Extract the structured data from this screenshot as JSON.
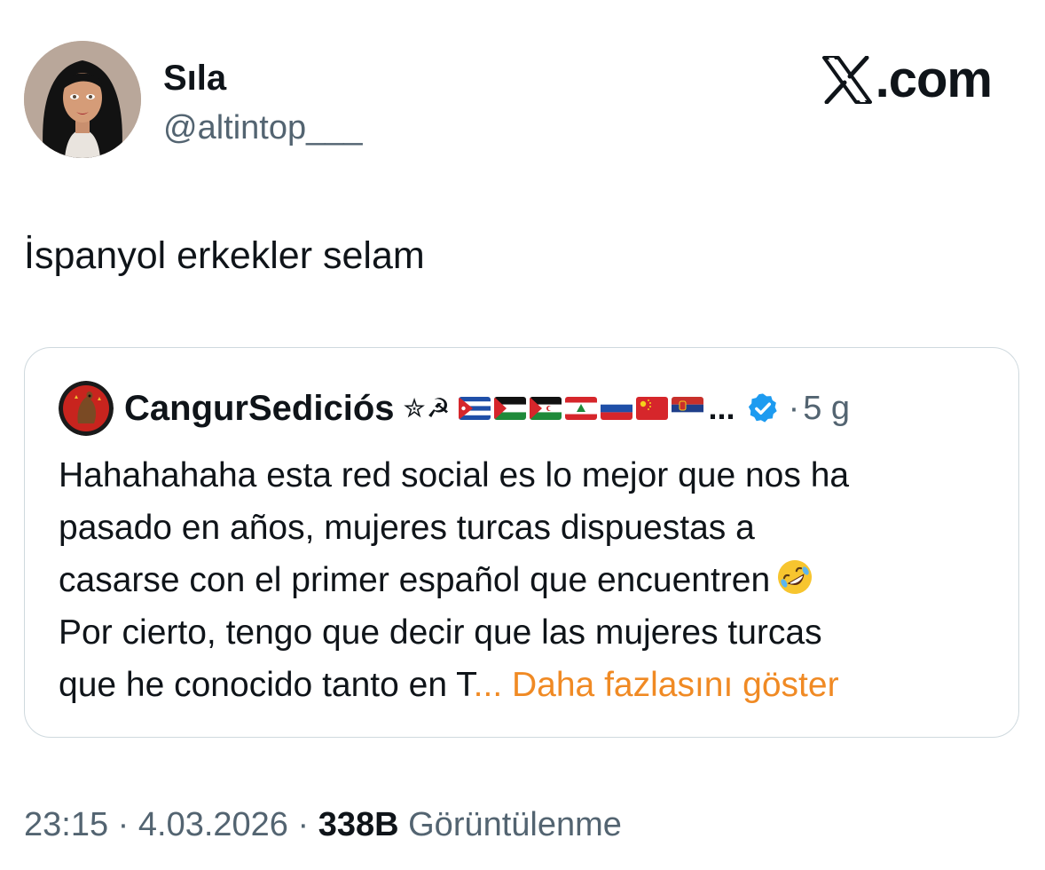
{
  "author": {
    "display_name": "Sıla",
    "handle": "@altintop___"
  },
  "brand": {
    "text": ".com",
    "icon": "x-logo-icon"
  },
  "tweet": {
    "text": "İspanyol erkekler selam"
  },
  "quoted_tweet": {
    "display_name": "CangurSediciós",
    "symbols": "✮☭",
    "flags": [
      "cuba-flag-icon",
      "palestine-flag-icon",
      "sahrawi-flag-icon",
      "lebanon-flag-icon",
      "russia-flag-icon",
      "china-flag-icon",
      "serbia-flag-icon"
    ],
    "name_ellipsis": "...",
    "verified_icon": "verified-badge-icon",
    "separator": "·",
    "time": "5 g",
    "lines": [
      "Hahahahaha esta red social es lo mejor que nos ha",
      "pasado en años, mujeres turcas dispuestas a",
      "casarse con el primer español que encuentren",
      "Por cierto, tengo que decir que las mujeres turcas",
      "que he conocido tanto en T"
    ],
    "emoji": "rolling-on-floor-laughing-emoji",
    "show_more": "... Daha fazlasını göster"
  },
  "meta": {
    "time": "23:15",
    "separator": "·",
    "date": "4.03.2026",
    "views_count": "338B",
    "views_label": "Görüntülenme"
  },
  "colors": {
    "text": "#0f1419",
    "secondary": "#536471",
    "border": "#cfd9de",
    "verified": "#1d9bf0",
    "show_more": "#f08a24"
  }
}
